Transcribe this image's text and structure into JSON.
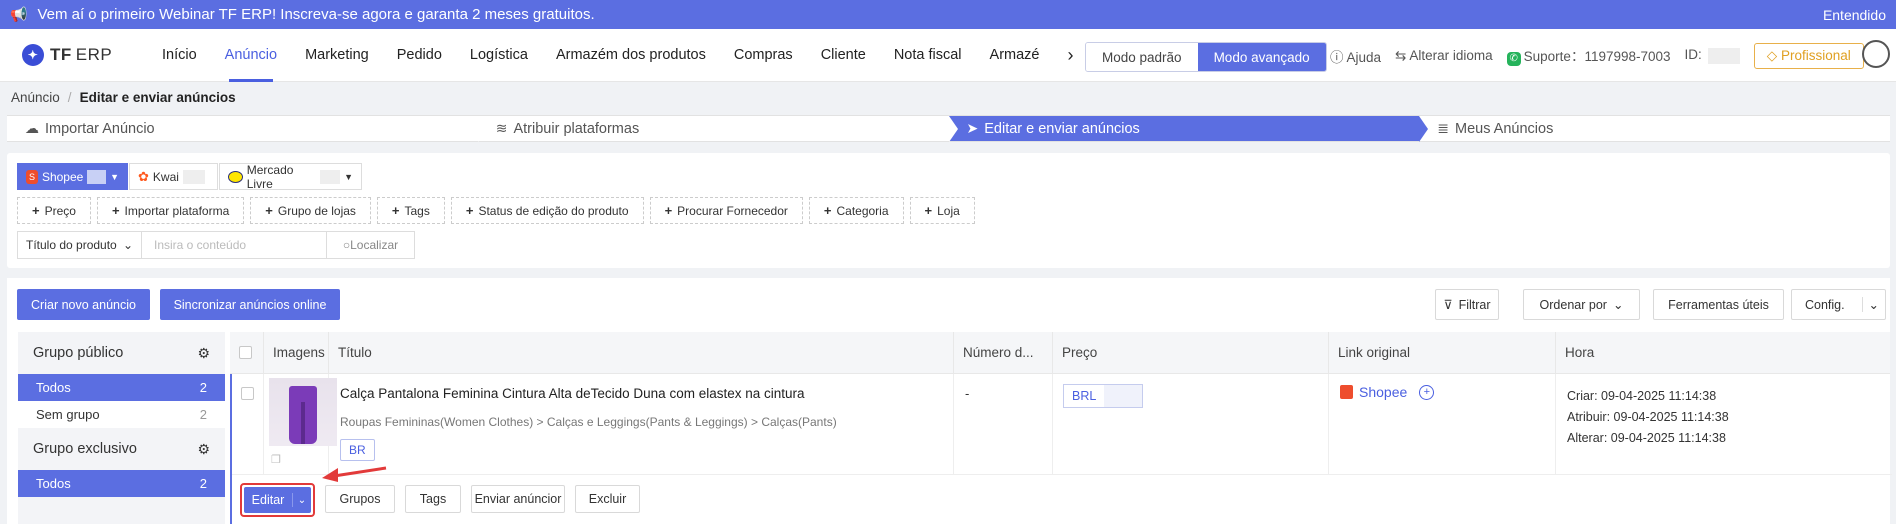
{
  "banner": {
    "text": "Vem aí o primeiro Webinar TF ERP! Inscreva-se agora e garanta 2 meses gratuitos.",
    "dismiss": "Entendido"
  },
  "logo": {
    "brand": "TF",
    "suffix": "ERP"
  },
  "nav": {
    "items": [
      "Início",
      "Anúncio",
      "Marketing",
      "Pedido",
      "Logística",
      "Armazém dos produtos",
      "Compras",
      "Cliente",
      "Nota fiscal",
      "Armazé"
    ],
    "active": 1,
    "more": "›"
  },
  "modes": {
    "standard": "Modo padrão",
    "advanced": "Modo avançado"
  },
  "header_right": {
    "help": "Ajuda",
    "language": "Alterar idioma",
    "support": "Suporte：1197998-7003",
    "id_label": "ID:",
    "plan": "Profissional"
  },
  "breadcrumb": {
    "root": "Anúncio",
    "current": "Editar e enviar anúncios"
  },
  "steps": [
    {
      "label": "Importar Anúncio",
      "icon": "cloud-upload-icon"
    },
    {
      "label": "Atribuir plataformas",
      "icon": "database-icon"
    },
    {
      "label": "Editar e enviar anúncios",
      "icon": "send-icon"
    },
    {
      "label": "Meus Anúncios",
      "icon": "stack-icon"
    }
  ],
  "platforms": {
    "shopee": "Shopee",
    "kwai": "Kwai",
    "mercado": "Mercado Livre"
  },
  "filter_chips": [
    "Preço",
    "Importar plataforma",
    "Grupo de lojas",
    "Tags",
    "Status de edição do produto",
    "Procurar Fornecedor",
    "Categoria",
    "Loja"
  ],
  "search": {
    "field": "Título do produto",
    "placeholder": "Insira o conteúdo",
    "button": "Localizar"
  },
  "toolbar": {
    "create": "Criar novo anúncio",
    "sync": "Sincronizar anúncios online",
    "filter": "Filtrar",
    "sort": "Ordenar por",
    "tools": "Ferramentas úteis",
    "config": "Config."
  },
  "groups": {
    "public_title": "Grupo público",
    "public_items": [
      {
        "label": "Todos",
        "count": "2"
      },
      {
        "label": "Sem grupo",
        "count": "2"
      }
    ],
    "exclusive_title": "Grupo exclusivo",
    "exclusive_items": [
      {
        "label": "Todos",
        "count": "2"
      }
    ]
  },
  "table": {
    "headers": [
      "Imagens",
      "Título",
      "Número d...",
      "Preço",
      "Link original",
      "Hora"
    ],
    "rows": [
      {
        "title": "Calça Pantalona Feminina Cintura Alta deTecido Duna com elastex na cintura",
        "category": "Roupas Femininas(Women Clothes) > Calças e Leggings(Pants & Leggings) > Calças(Pants)",
        "tag": "BR",
        "number": "-",
        "currency": "BRL",
        "link": "Shopee",
        "created": "Criar:  09-04-2025 11:14:38",
        "assigned": "Atribuir:  09-04-2025 11:14:38",
        "modified": "Alterar:  09-04-2025 11:14:38"
      }
    ]
  },
  "row_actions": {
    "edit": "Editar",
    "groups": "Grupos",
    "tags": "Tags",
    "send": "Enviar anúncior",
    "delete": "Excluir"
  },
  "colors": {
    "accent": "#5b6ee1",
    "highlight": "#e23a3a",
    "shopee": "#ee4d2d"
  }
}
